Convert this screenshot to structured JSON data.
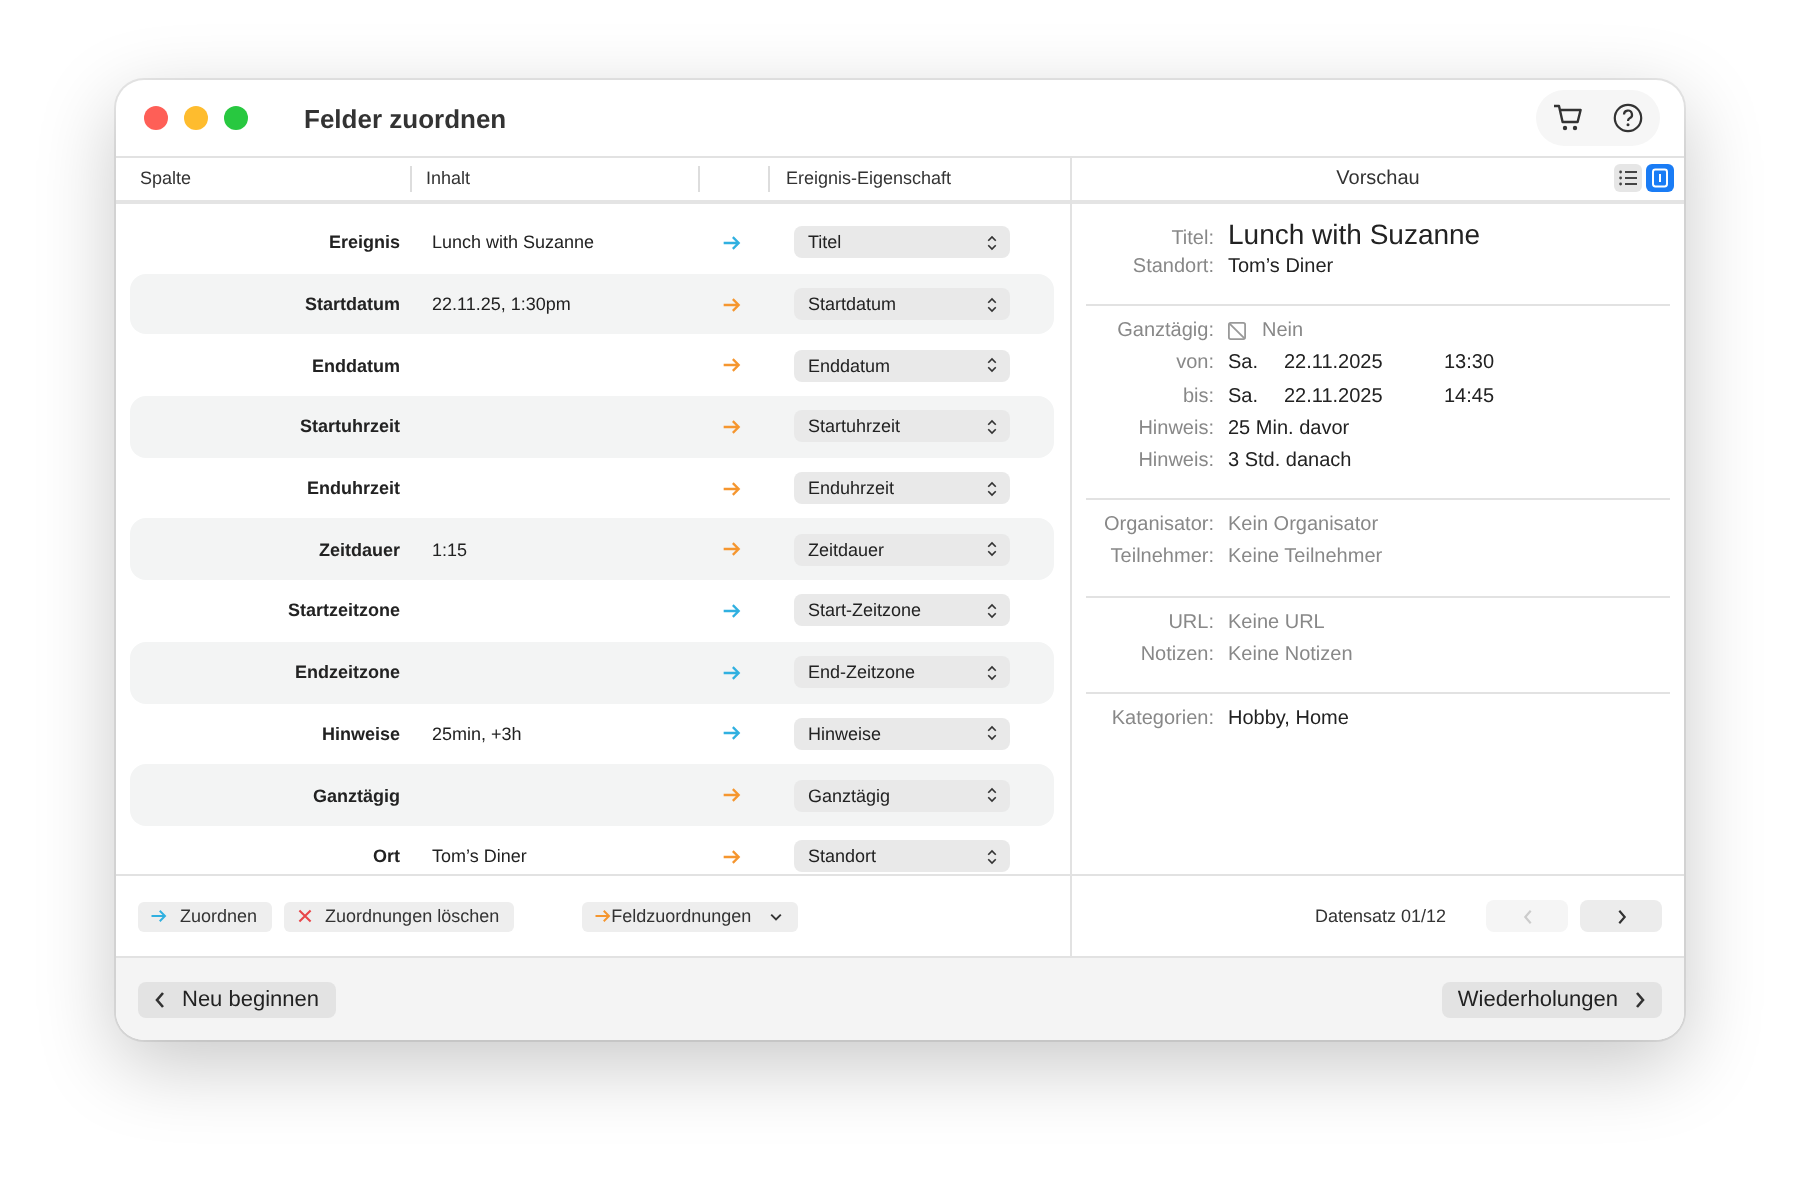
{
  "window": {
    "title": "Felder zuordnen"
  },
  "toolbar_icons": [
    {
      "kind": "cart"
    },
    {
      "kind": "help"
    }
  ],
  "table": {
    "columns": [
      "Spalte",
      "Inhalt",
      "Ereignis-Eigenschaft"
    ],
    "rows": [
      {
        "column": "Ereignis",
        "content": "Lunch with Suzanne",
        "color": "#30b0e0",
        "property": "Titel"
      },
      {
        "column": "Startdatum",
        "content": "22.11.25, 1:30pm",
        "color": "#f5962f",
        "property": "Startdatum"
      },
      {
        "column": "Enddatum",
        "color": "#f5962f",
        "property": "Enddatum"
      },
      {
        "column": "Startuhrzeit",
        "color": "#f5962f",
        "property": "Startuhrzeit"
      },
      {
        "column": "Enduhrzeit",
        "color": "#f5962f",
        "property": "Enduhrzeit"
      },
      {
        "column": "Zeitdauer",
        "content": "1:15",
        "color": "#f5962f",
        "property": "Zeitdauer"
      },
      {
        "column": "Startzeitzone",
        "color": "#30b0e0",
        "property": "Start-Zeitzone"
      },
      {
        "column": "Endzeitzone",
        "color": "#30b0e0",
        "property": "End-Zeitzone"
      },
      {
        "column": "Hinweise",
        "content": "25min, +3h",
        "color": "#30b0e0",
        "property": "Hinweise"
      },
      {
        "column": "Ganztägig",
        "color": "#f5962f",
        "property": "Ganztägig"
      },
      {
        "column": "Ort",
        "content": "Tom’s Diner",
        "color": "#f5962f",
        "property": "Standort"
      }
    ]
  },
  "preview": {
    "title": "Vorschau",
    "view_toggle": [
      {
        "kind": "list",
        "selected": false
      },
      {
        "kind": "single",
        "selected": true
      }
    ],
    "sections": [
      {
        "rows": [
          {
            "kind": "title",
            "label": "Titel:",
            "value": "Lunch with Suzanne",
            "muted": false
          },
          {
            "kind": "text",
            "label": "Standort:",
            "value": "Tom’s Diner",
            "muted": false
          }
        ]
      },
      {
        "rows": [
          {
            "kind": "checkbox",
            "label": "Ganztägig:",
            "value": "Nein",
            "checked": false,
            "muted": true
          },
          {
            "kind": "datetime",
            "label": "von:",
            "parts": [
              "Sa.",
              "22.11.2025",
              "13:30"
            ]
          },
          {
            "kind": "datetime",
            "label": "bis:",
            "parts": [
              "Sa.",
              "22.11.2025",
              "14:45"
            ]
          },
          {
            "kind": "text",
            "label": "Hinweis:",
            "value": "25 Min. davor",
            "muted": false
          },
          {
            "kind": "text",
            "label": "Hinweis:",
            "value": "3 Std. danach",
            "muted": false
          }
        ]
      },
      {
        "rows": [
          {
            "kind": "text",
            "label": "Organisator:",
            "value": "Kein Organisator",
            "muted": true
          },
          {
            "kind": "text",
            "label": "Teilnehmer:",
            "value": "Keine Teilnehmer",
            "muted": true
          }
        ]
      },
      {
        "rows": [
          {
            "kind": "text",
            "label": "URL:",
            "value": "Keine URL",
            "muted": true
          },
          {
            "kind": "text",
            "label": "Notizen:",
            "value": "Keine Notizen",
            "muted": true
          }
        ]
      },
      {
        "rows": [
          {
            "kind": "text",
            "label": "Kategorien:",
            "value": "Hobby, Home",
            "muted": false
          }
        ]
      }
    ]
  },
  "actions": [
    {
      "kind": "assign",
      "label": "Zuordnen"
    },
    {
      "kind": "clear",
      "label": "Zuordnungen löschen"
    },
    {
      "kind": "menu",
      "label": "Feldzuordnungen"
    }
  ],
  "record": {
    "label": "Datensatz 01/12",
    "prev_disabled": true,
    "next_disabled": false
  },
  "footer": {
    "back": "Neu beginnen",
    "next": "Wiederholungen"
  }
}
